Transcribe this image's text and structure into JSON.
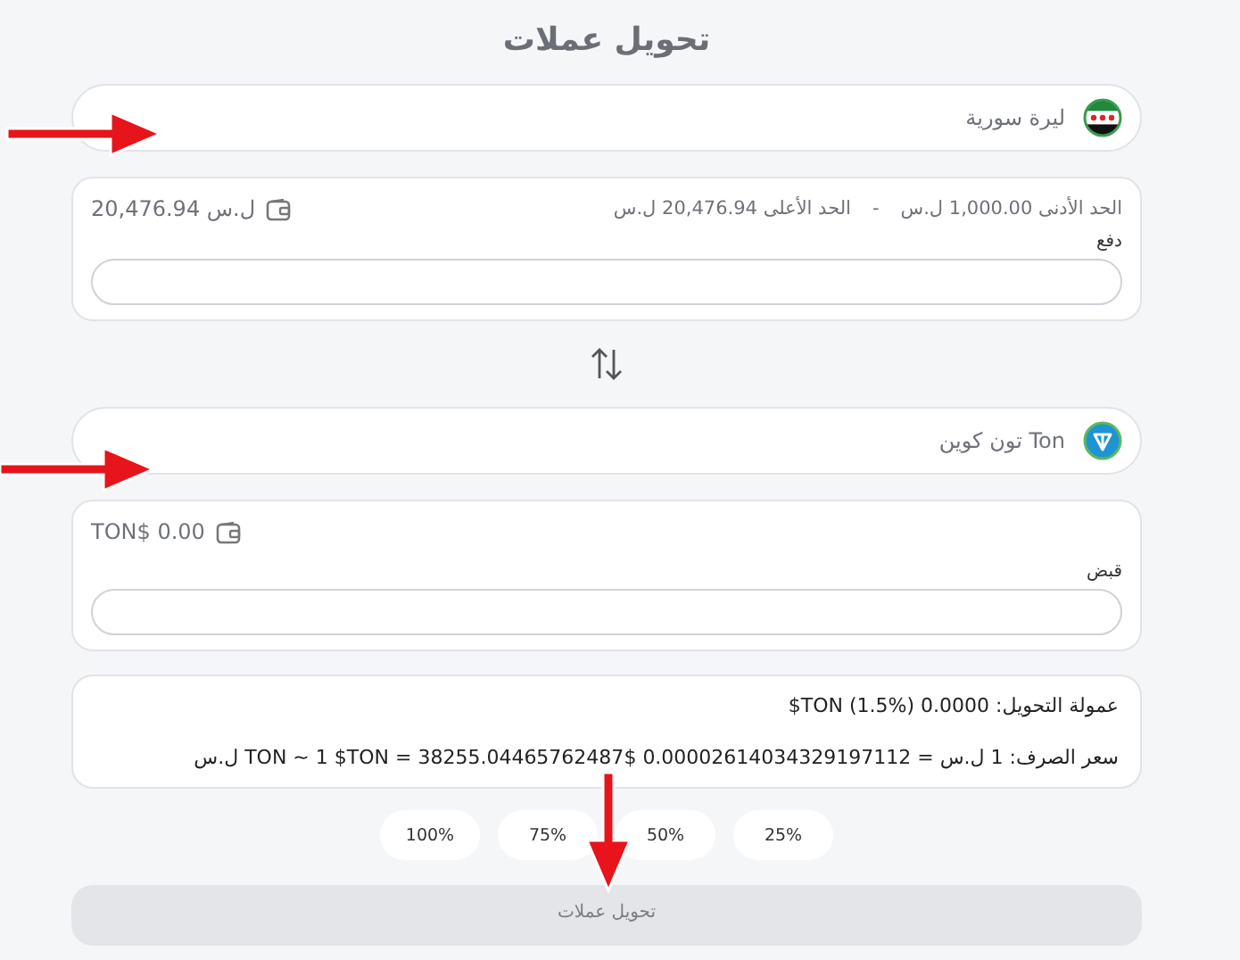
{
  "title": "تحويل عملات",
  "from_currency": {
    "label": "ليرة سورية",
    "kind": "flag"
  },
  "pay_panel": {
    "balance": "20,476.94 ل.س",
    "min_limit": "الحد الأدنى 1,000.00 ل.س",
    "separator": "-",
    "max_limit": "الحد الأعلى 20,476.94 ل.س",
    "field_label": "دفع"
  },
  "to_currency": {
    "label": "Ton تون كوين",
    "kind": "coin"
  },
  "receive_panel": {
    "balance": "TON$ 0.00",
    "field_label": "قبض"
  },
  "info": {
    "fee": "عمولة التحويل: 0.0000 (%1.5) TON$",
    "rate": "سعر الصرف: 1 ل.س = 0.00002614034329197112 $TON ~ 1 $TON = 38255.04465762487 ل.س"
  },
  "percent_buttons": [
    "25%",
    "50%",
    "75%",
    "100%"
  ],
  "submit": {
    "label": "تحويل عملات",
    "disabled": true
  }
}
